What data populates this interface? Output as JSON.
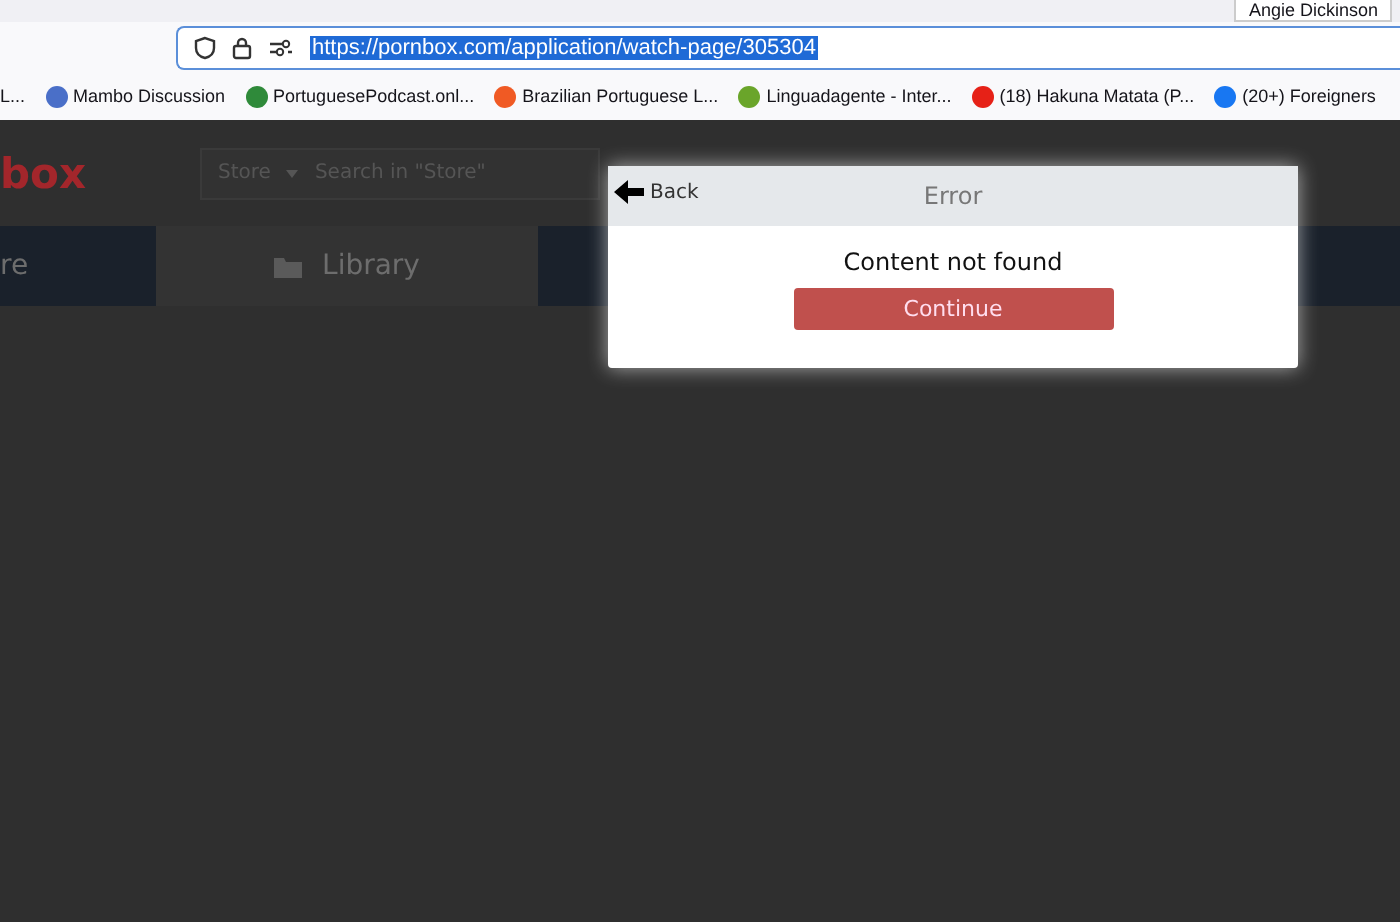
{
  "browser": {
    "profile_text": "Angie Dickinson",
    "address_url": "https://pornbox.com/application/watch-page/305304",
    "bookmarks": [
      {
        "label": "L..."
      },
      {
        "label": "Mambo Discussion",
        "color": "#4a6fc8"
      },
      {
        "label": "PortuguesePodcast.onl...",
        "color": "#2f8a3a"
      },
      {
        "label": "Brazilian Portuguese L...",
        "color": "#f05a24"
      },
      {
        "label": "Linguadagente - Inter...",
        "color": "#6aa52a"
      },
      {
        "label": "(18) Hakuna Matata (P...",
        "color": "#e62117"
      },
      {
        "label": "(20+) Foreigners",
        "color": "#1877f2"
      }
    ]
  },
  "site": {
    "logo": "box",
    "search": {
      "scope": "Store",
      "placeholder": "Search in \"Store\""
    },
    "nav": [
      {
        "label": "re",
        "selected": false
      },
      {
        "label": "Library",
        "selected": true
      }
    ]
  },
  "dialog": {
    "back": "Back",
    "title": "Error",
    "message": "Content not found",
    "button": "Continue"
  }
}
